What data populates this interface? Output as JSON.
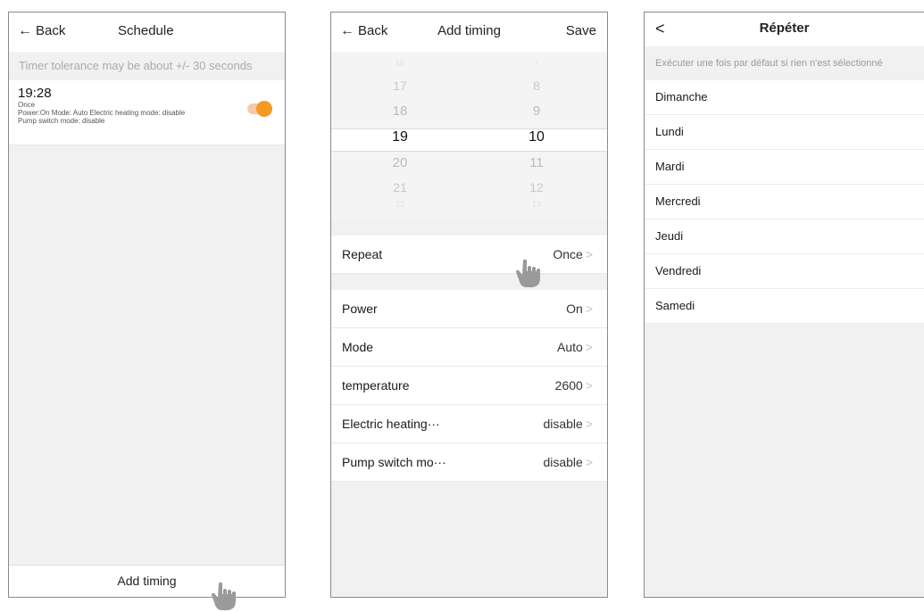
{
  "screen1": {
    "back_label": "Back",
    "title": "Schedule",
    "tolerance_note": "Timer tolerance may be about +/- 30 seconds",
    "timer": {
      "time": "19:28",
      "repeat": "Once",
      "details_line1": "Power:On Mode: Auto Electric heating mode: disable",
      "details_line2": "Pump switch mode: disable",
      "enabled": true
    },
    "add_button": "Add timing"
  },
  "screen2": {
    "back_label": "Back",
    "title": "Add timing",
    "save_label": "Save",
    "hours": [
      "16",
      "17",
      "18",
      "19",
      "20",
      "21",
      "22"
    ],
    "minutes": [
      "7",
      "8",
      "9",
      "10",
      "11",
      "12",
      "13"
    ],
    "selected_hour": "19",
    "selected_minute": "10",
    "settings": [
      {
        "label": "Repeat",
        "value": "Once"
      },
      {
        "label": "Power",
        "value": "On"
      },
      {
        "label": "Mode",
        "value": "Auto"
      },
      {
        "label": "temperature",
        "value": "2600"
      },
      {
        "label": "Electric heating···",
        "value": "disable"
      },
      {
        "label": "Pump switch mo···",
        "value": "disable"
      }
    ]
  },
  "screen3": {
    "back_glyph": "<",
    "title": "Répéter",
    "note": "Exécuter une fois par défaut si rien n'est sélectionné",
    "days": [
      "Dimanche",
      "Lundi",
      "Mardi",
      "Mercredi",
      "Jeudi",
      "Vendredi",
      "Samedi"
    ]
  },
  "colors": {
    "accent": "#f59a23",
    "toggle_track": "#f8c9a8",
    "background": "#f1f1f1"
  }
}
